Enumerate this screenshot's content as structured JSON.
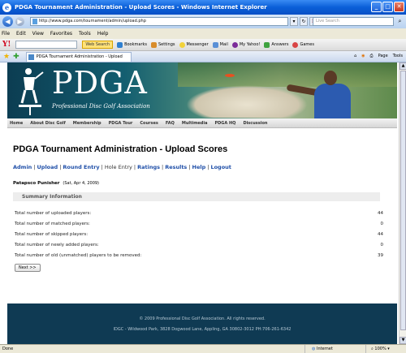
{
  "window": {
    "title": "PDGA Tournament Administration - Upload Scores - Windows Internet Explorer"
  },
  "address": {
    "url": "http://www.pdga.com/tournament/admin/upload.php",
    "search_placeholder": "Live Search"
  },
  "menu": [
    "File",
    "Edit",
    "View",
    "Favorites",
    "Tools",
    "Help"
  ],
  "yahoo_toolbar": {
    "web_search": "Web Search",
    "bookmarks": "Bookmarks",
    "settings": "Settings",
    "messenger": "Messenger",
    "mail": "Mail",
    "my_yahoo": "My Yahoo!",
    "answers": "Answers",
    "games": "Games"
  },
  "tab": {
    "label": "PDGA Tournament Administration - Upload Scores"
  },
  "command_bar": {
    "page": "Page",
    "tools": "Tools"
  },
  "banner": {
    "logo": "PDGA",
    "tagline": "Professional Disc Golf Association"
  },
  "site_nav": [
    "Home",
    "About Disc Golf",
    "Membership",
    "PDGA Tour",
    "Courses",
    "FAQ",
    "Multimedia",
    "PDGA HQ",
    "Discussion"
  ],
  "page": {
    "title": "PDGA Tournament Administration - Upload Scores",
    "links": [
      "Admin",
      "Upload",
      "Round Entry",
      "Hole Entry",
      "Ratings",
      "Results",
      "Help",
      "Logout"
    ],
    "event_name": "Patapsco Punisher",
    "event_date": "(Sat, Apr 4, 2009)",
    "summary_header": "Summary Information",
    "summary": [
      {
        "label": "Total number of uploaded players:",
        "value": "44"
      },
      {
        "label": "Total number of matched players:",
        "value": "0"
      },
      {
        "label": "Total number of skipped players:",
        "value": "44"
      },
      {
        "label": "Total number of newly added players:",
        "value": "0"
      },
      {
        "label": "Total number of old (unmatched) players to be removed:",
        "value": "39"
      }
    ],
    "next_button": "Next >>"
  },
  "footer": {
    "line1": "© 2009 Professional Disc Golf Association. All rights reserved.",
    "line2": "IDGC - Wildwood Park, 3828 Dogwood Lane, Appling, GA 30802-3012 PH:706-261-6342"
  },
  "status": {
    "text": "Done",
    "zone": "Internet",
    "zoom": "100%"
  }
}
